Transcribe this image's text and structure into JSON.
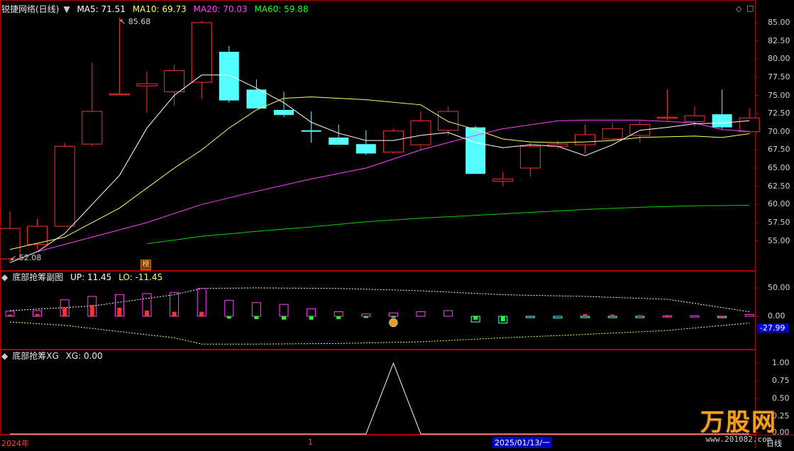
{
  "colors": {
    "up": "#ff3030",
    "down": "#55ffff",
    "ma5": "#ffffff",
    "ma10": "#ffff60",
    "ma20": "#ff40ff",
    "ma60": "#00d000",
    "frame": "#b00000",
    "axis_text": "#d0d0d0",
    "bg": "#000000"
  },
  "header_main": {
    "title": "锐捷网络(日线)",
    "ma5": "MA5: 71.51",
    "ma10": "MA10: 69.73",
    "ma20": "MA20: 70.03",
    "ma60": "MA60: 59.88"
  },
  "header_sub1": {
    "title": "底部抢筹副图",
    "up": "UP: 11.45",
    "lo": "LO: -11.45"
  },
  "header_sub2": {
    "title": "底部抢筹XG",
    "xg": "XG: 0.00"
  },
  "price_axis": [
    "85.00",
    "82.50",
    "80.00",
    "77.50",
    "75.00",
    "72.50",
    "70.00",
    "67.50",
    "65.00",
    "62.50",
    "60.00",
    "57.50",
    "55.00"
  ],
  "sub1_axis": [
    "50.00",
    "0.00"
  ],
  "sub1_current": "-27.99",
  "sub2_axis": [
    "1.00",
    "0.75",
    "0.50",
    "0.25",
    "0.00"
  ],
  "annotations": {
    "high": "85.68",
    "low": "52.08",
    "badge": "榜"
  },
  "bottom_bar": {
    "year": "2024年",
    "marker": "1",
    "date": "2025/01/13/一",
    "period": "日线"
  },
  "corner_icons": [
    "diamond-icon",
    "square-icon"
  ],
  "watermark": {
    "brand": "万股网",
    "url": "www.201082.com"
  },
  "chart_data": {
    "type": "candlestick",
    "candles": [
      {
        "o": 52.5,
        "h": 59.0,
        "l": 52.1,
        "c": 56.7
      },
      {
        "o": 54.5,
        "h": 58.0,
        "l": 53.8,
        "c": 57.0
      },
      {
        "o": 57.0,
        "h": 68.5,
        "l": 57.0,
        "c": 68.0
      },
      {
        "o": 68.3,
        "h": 79.5,
        "l": 68.0,
        "c": 72.8
      },
      {
        "o": 75.2,
        "h": 85.68,
        "l": 75.2,
        "c": 75.2
      },
      {
        "o": 76.3,
        "h": 78.3,
        "l": 72.6,
        "c": 76.6
      },
      {
        "o": 75.5,
        "h": 79.2,
        "l": 73.6,
        "c": 78.4
      },
      {
        "o": 76.8,
        "h": 85.3,
        "l": 74.5,
        "c": 85.0
      },
      {
        "o": 81.0,
        "h": 81.8,
        "l": 74.0,
        "c": 74.3
      },
      {
        "o": 75.8,
        "h": 77.2,
        "l": 73.2,
        "c": 73.2
      },
      {
        "o": 73.0,
        "h": 75.5,
        "l": 72.0,
        "c": 72.3
      },
      {
        "o": 70.2,
        "h": 72.8,
        "l": 68.5,
        "c": 70.0
      },
      {
        "o": 69.2,
        "h": 71.0,
        "l": 68.2,
        "c": 68.2
      },
      {
        "o": 68.3,
        "h": 70.2,
        "l": 66.8,
        "c": 67.0
      },
      {
        "o": 67.2,
        "h": 70.4,
        "l": 67.0,
        "c": 70.1
      },
      {
        "o": 68.2,
        "h": 72.8,
        "l": 67.5,
        "c": 71.5
      },
      {
        "o": 70.2,
        "h": 73.5,
        "l": 69.5,
        "c": 72.8
      },
      {
        "o": 70.6,
        "h": 70.8,
        "l": 64.2,
        "c": 64.2
      },
      {
        "o": 63.2,
        "h": 64.5,
        "l": 62.5,
        "c": 63.5
      },
      {
        "o": 65.0,
        "h": 68.5,
        "l": 63.8,
        "c": 68.0
      },
      {
        "o": 68.0,
        "h": 68.8,
        "l": 67.6,
        "c": 68.3
      },
      {
        "o": 68.2,
        "h": 71.0,
        "l": 67.0,
        "c": 69.6
      },
      {
        "o": 69.0,
        "h": 71.2,
        "l": 68.8,
        "c": 70.4
      },
      {
        "o": 69.5,
        "h": 71.5,
        "l": 68.5,
        "c": 71.0
      },
      {
        "o": 71.9,
        "h": 75.8,
        "l": 71.5,
        "c": 72.0
      },
      {
        "o": 71.4,
        "h": 73.5,
        "l": 70.7,
        "c": 72.2
      },
      {
        "o": 72.4,
        "h": 75.8,
        "l": 70.4,
        "c": 70.6
      },
      {
        "o": 70.0,
        "h": 73.2,
        "l": 69.8,
        "c": 71.9
      }
    ],
    "ma5": [
      [
        1,
        52.0
      ],
      [
        2,
        53.5
      ],
      [
        3,
        56.0
      ],
      [
        4,
        60.0
      ],
      [
        5,
        64.0
      ],
      [
        6,
        70.5
      ],
      [
        7,
        75.0
      ],
      [
        8,
        77.8
      ],
      [
        9,
        77.8
      ],
      [
        10,
        76.0
      ],
      [
        11,
        74.0
      ],
      [
        12,
        71.3
      ],
      [
        13,
        69.8
      ],
      [
        14,
        68.8
      ],
      [
        15,
        68.8
      ],
      [
        16,
        69.5
      ],
      [
        17,
        69.9
      ],
      [
        18,
        68.5
      ],
      [
        19,
        67.8
      ],
      [
        20,
        68.2
      ],
      [
        21,
        68.0
      ],
      [
        22,
        66.7
      ],
      [
        23,
        68.2
      ],
      [
        24,
        70.2
      ],
      [
        25,
        70.6
      ],
      [
        26,
        71.1
      ],
      [
        27,
        71.2
      ],
      [
        28,
        71.51
      ]
    ],
    "ma10": [
      [
        1,
        53.8
      ],
      [
        3,
        55.5
      ],
      [
        5,
        59.5
      ],
      [
        7,
        65.0
      ],
      [
        8,
        67.5
      ],
      [
        9,
        70.5
      ],
      [
        10,
        73.0
      ],
      [
        11,
        74.6
      ],
      [
        12,
        74.8
      ],
      [
        14,
        74.4
      ],
      [
        16,
        73.7
      ],
      [
        17,
        71.4
      ],
      [
        18,
        70.3
      ],
      [
        19,
        69.0
      ],
      [
        20,
        68.6
      ],
      [
        21,
        68.5
      ],
      [
        22,
        68.6
      ],
      [
        23,
        68.8
      ],
      [
        24,
        69.2
      ],
      [
        25,
        69.3
      ],
      [
        26,
        69.4
      ],
      [
        27,
        69.2
      ],
      [
        28,
        69.73
      ]
    ],
    "ma20": [
      [
        2,
        53.5
      ],
      [
        4,
        55.5
      ],
      [
        6,
        57.5
      ],
      [
        8,
        60.0
      ],
      [
        10,
        61.8
      ],
      [
        12,
        63.5
      ],
      [
        14,
        65.0
      ],
      [
        16,
        67.5
      ],
      [
        17,
        68.5
      ],
      [
        18,
        69.5
      ],
      [
        19,
        70.4
      ],
      [
        21,
        71.5
      ],
      [
        22,
        71.6
      ],
      [
        24,
        71.6
      ],
      [
        26,
        71.2
      ],
      [
        27,
        70.3
      ],
      [
        28,
        70.03
      ]
    ],
    "ma60": [
      [
        6,
        54.6
      ],
      [
        8,
        55.6
      ],
      [
        10,
        56.3
      ],
      [
        12,
        56.9
      ],
      [
        14,
        57.6
      ],
      [
        16,
        58.1
      ],
      [
        18,
        58.5
      ],
      [
        20,
        58.9
      ],
      [
        22,
        59.3
      ],
      [
        24,
        59.6
      ],
      [
        26,
        59.8
      ],
      [
        28,
        59.88
      ]
    ],
    "sub1_bars": [
      {
        "v": 9,
        "inner": 3,
        "kind": "up"
      },
      {
        "v": 10,
        "inner": 4,
        "kind": "up"
      },
      {
        "v": 29,
        "inner": 16,
        "kind": "up"
      },
      {
        "v": 35,
        "inner": 20,
        "kind": "up"
      },
      {
        "v": 38,
        "inner": 15,
        "kind": "up"
      },
      {
        "v": 40,
        "inner": 10,
        "kind": "up"
      },
      {
        "v": 42,
        "inner": 8,
        "kind": "up"
      },
      {
        "v": 49,
        "inner": 8,
        "kind": "up"
      },
      {
        "v": 28,
        "inner": -4,
        "kind": "fade"
      },
      {
        "v": 24,
        "inner": -5,
        "kind": "fade"
      },
      {
        "v": 21,
        "inner": -6,
        "kind": "fade"
      },
      {
        "v": 13,
        "inner": -6,
        "kind": "fade"
      },
      {
        "v": 8,
        "inner": -5,
        "kind": "fade"
      },
      {
        "v": 4,
        "inner": -3,
        "kind": "fade"
      },
      {
        "v": 6,
        "inner": -2,
        "kind": "fade"
      },
      {
        "v": 8,
        "inner": 0,
        "kind": "fade"
      },
      {
        "v": 10,
        "inner": 0,
        "kind": "fade"
      },
      {
        "v": -10,
        "inner": -6,
        "kind": "cyan"
      },
      {
        "v": -12,
        "inner": -9,
        "kind": "cyan"
      },
      {
        "v": -2,
        "inner": 0,
        "kind": "cyan"
      },
      {
        "v": -3,
        "inner": 0,
        "kind": "cyan"
      },
      {
        "v": -2,
        "inner": 4,
        "kind": "cyan"
      },
      {
        "v": -1,
        "inner": 3,
        "kind": "cyan"
      },
      {
        "v": -1,
        "inner": 2,
        "kind": "cyan"
      },
      {
        "v": 1,
        "inner": 1,
        "kind": "mag"
      },
      {
        "v": 1,
        "inner": 0,
        "kind": "mag"
      },
      {
        "v": -1,
        "inner": 1,
        "kind": "cyan"
      },
      {
        "v": 3,
        "inner": 0,
        "kind": "mag"
      }
    ],
    "sub1_upper": [
      [
        1,
        10
      ],
      [
        4,
        18
      ],
      [
        7,
        38
      ],
      [
        8,
        49
      ],
      [
        10,
        50
      ],
      [
        13,
        49
      ],
      [
        16,
        45
      ],
      [
        19,
        38
      ],
      [
        22,
        35
      ],
      [
        25,
        30
      ],
      [
        28,
        8
      ]
    ],
    "sub1_lower": [
      [
        1,
        -10
      ],
      [
        3,
        -16
      ],
      [
        7,
        -38
      ],
      [
        8,
        -49
      ],
      [
        10,
        -49
      ],
      [
        13,
        -48
      ],
      [
        16,
        -45
      ],
      [
        19,
        -38
      ],
      [
        22,
        -32
      ],
      [
        25,
        -25
      ],
      [
        28,
        -12
      ]
    ],
    "xg": [
      [
        1,
        0
      ],
      [
        14,
        0
      ],
      [
        15,
        1
      ],
      [
        16,
        0
      ],
      [
        28,
        0
      ]
    ]
  }
}
